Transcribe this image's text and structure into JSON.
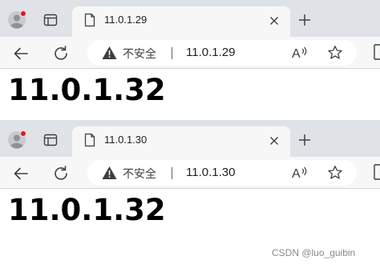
{
  "windows": [
    {
      "tab": {
        "title": "11.0.1.29",
        "close_icon": "close-icon",
        "page_icon": "page-icon"
      },
      "address_bar": {
        "security_label": "不安全",
        "url": "11.0.1.29",
        "read_aloud_label": "A",
        "security_icon": "warning-triangle-icon"
      },
      "page": {
        "heading": "11.0.1.32"
      }
    },
    {
      "tab": {
        "title": "11.0.1.30",
        "close_icon": "close-icon",
        "page_icon": "page-icon"
      },
      "address_bar": {
        "security_label": "不安全",
        "url": "11.0.1.30",
        "read_aloud_label": "A",
        "security_icon": "warning-triangle-icon"
      },
      "page": {
        "heading": "11.0.1.32"
      }
    }
  ],
  "watermark": "CSDN @luo_guibin",
  "colors": {
    "tab_strip": "#dfe3e8",
    "toolbar": "#f7f7f7",
    "badge_red": "#e81123",
    "icon_gray": "#5f6368"
  }
}
